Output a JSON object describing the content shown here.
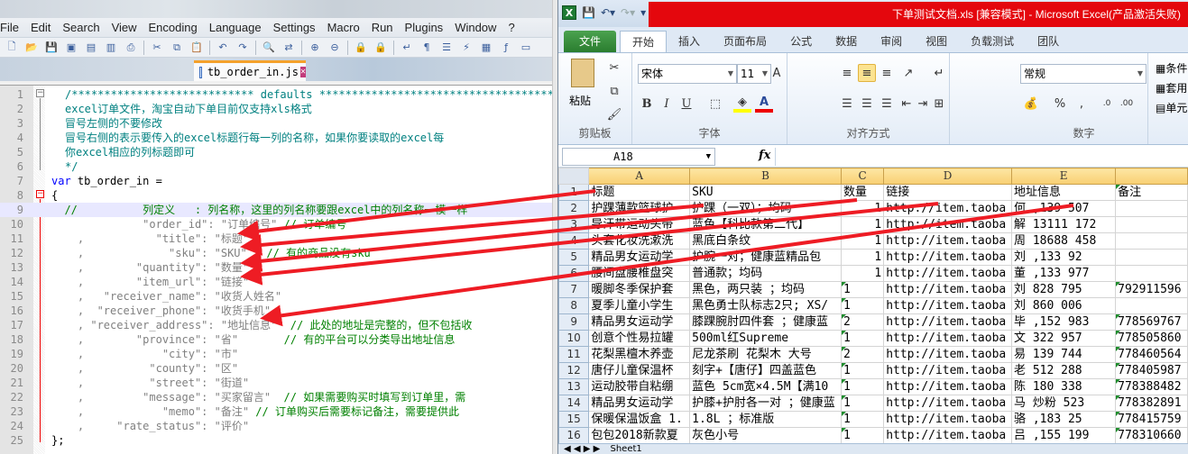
{
  "notepadpp": {
    "menu": [
      "File",
      "Edit",
      "Search",
      "View",
      "Encoding",
      "Language",
      "Settings",
      "Macro",
      "Run",
      "Plugins",
      "Window",
      "?"
    ],
    "tab_label": "tb_order_in.js",
    "lines": [
      {
        "n": "1",
        "parts": [
          {
            "t": "/**************************** defaults *****************************************",
            "c": "comment"
          }
        ]
      },
      {
        "n": "2",
        "parts": [
          {
            "t": "excel订单文件，淘宝自动下单目前仅支持xls格式",
            "c": "comment"
          }
        ]
      },
      {
        "n": "3",
        "parts": [
          {
            "t": "冒号左侧的不要修改",
            "c": "comment"
          }
        ]
      },
      {
        "n": "4",
        "parts": [
          {
            "t": "冒号右侧的表示要传入的excel标题行每一列的名称，如果你要读取的excel每",
            "c": "comment"
          }
        ]
      },
      {
        "n": "5",
        "parts": [
          {
            "t": "你excel相应的列标题即可",
            "c": "comment"
          }
        ]
      },
      {
        "n": "6",
        "parts": [
          {
            "t": "*/",
            "c": "comment"
          }
        ]
      },
      {
        "n": "7",
        "parts": [
          {
            "t": "var",
            "c": "kw"
          },
          {
            "t": " tb_order_in =",
            "c": "ident"
          }
        ]
      },
      {
        "n": "8",
        "parts": [
          {
            "t": "{",
            "c": "ident"
          }
        ]
      },
      {
        "n": "9",
        "parts": [
          {
            "t": "  //          列定义   : 列名称，这里的列名称要跟excel中的列名称一模一样",
            "c": "green"
          }
        ]
      },
      {
        "n": "10",
        "parts": [
          {
            "t": "              \"order_id\": \"订单编号\" ",
            "c": "str"
          },
          {
            "t": "// 订单编号",
            "c": "green"
          }
        ]
      },
      {
        "n": "11",
        "parts": [
          {
            "t": "    ,           \"title\": \"标题\"",
            "c": "str"
          }
        ]
      },
      {
        "n": "12",
        "parts": [
          {
            "t": "    ,             \"sku\": \"SKU\"   ",
            "c": "str"
          },
          {
            "t": "// 有的商品没有sku",
            "c": "green"
          }
        ]
      },
      {
        "n": "13",
        "parts": [
          {
            "t": "    ,        \"quantity\": \"数量\"",
            "c": "str"
          }
        ]
      },
      {
        "n": "14",
        "parts": [
          {
            "t": "    ,        \"item_url\": \"链接\"",
            "c": "str"
          }
        ]
      },
      {
        "n": "15",
        "parts": [
          {
            "t": "    ,   \"receiver_name\": \"收货人姓名\"",
            "c": "str"
          }
        ]
      },
      {
        "n": "16",
        "parts": [
          {
            "t": "    ,  \"receiver_phone\": \"收货手机\"",
            "c": "str"
          }
        ]
      },
      {
        "n": "17",
        "parts": [
          {
            "t": "    , \"receiver_address\": \"地址信息\"  ",
            "c": "str"
          },
          {
            "t": "// 此处的地址是完整的，但不包括收",
            "c": "green"
          }
        ]
      },
      {
        "n": "18",
        "parts": [
          {
            "t": "    ,        \"province\": \"省\"       ",
            "c": "str"
          },
          {
            "t": "// 有的平台可以分类导出地址信息",
            "c": "green"
          }
        ]
      },
      {
        "n": "19",
        "parts": [
          {
            "t": "    ,            \"city\": \"市\"",
            "c": "str"
          }
        ]
      },
      {
        "n": "20",
        "parts": [
          {
            "t": "    ,          \"county\": \"区\"",
            "c": "str"
          }
        ]
      },
      {
        "n": "21",
        "parts": [
          {
            "t": "    ,          \"street\": \"街道\"",
            "c": "str"
          }
        ]
      },
      {
        "n": "22",
        "parts": [
          {
            "t": "    ,         \"message\": \"买家留言\"  ",
            "c": "str"
          },
          {
            "t": "// 如果需要购买时填写到订单里，需",
            "c": "green"
          }
        ]
      },
      {
        "n": "23",
        "parts": [
          {
            "t": "    ,            \"memo\": \"备注\" ",
            "c": "str"
          },
          {
            "t": "// 订单购买后需要标记备注，需要提供此",
            "c": "green"
          }
        ]
      },
      {
        "n": "24",
        "parts": [
          {
            "t": "    ,     \"rate_status\": \"评价\"",
            "c": "str"
          }
        ]
      },
      {
        "n": "25",
        "parts": [
          {
            "t": "};",
            "c": "ident"
          }
        ]
      }
    ]
  },
  "excel": {
    "title": "下单测试文档.xls  [兼容模式]  -  Microsoft Excel(产品激活失败)",
    "logo": "X",
    "tabs": [
      "文件",
      "开始",
      "插入",
      "页面布局",
      "公式",
      "数据",
      "审阅",
      "视图",
      "负载测试",
      "团队"
    ],
    "ribbon": {
      "paste": "粘贴",
      "clipboard_group": "剪贴板",
      "font_name": "宋体",
      "font_size": "11",
      "font_group": "字体",
      "align_group": "对齐方式",
      "number_format": "常规",
      "number_group": "数字",
      "styles": [
        "条件",
        "套用",
        "单元"
      ],
      "bold": "B",
      "italic": "I",
      "underline": "U"
    },
    "name_box": "A18",
    "fx": "fx",
    "columns": [
      "A",
      "B",
      "C",
      "D",
      "E",
      ""
    ],
    "rows": [
      {
        "n": "1",
        "a": "标题",
        "b": "SKU",
        "c": "数量",
        "d": "链接",
        "e": "地址信息",
        "f": "备注"
      },
      {
        "n": "2",
        "a": "护踝薄款篮球护",
        "b": "护踝（一双）；均码",
        "c": "1",
        "d": "http://item.taoba",
        "e": "何 ,139  507",
        "f": ""
      },
      {
        "n": "3",
        "a": "导汗带运动头带",
        "b": "蓝色【科比款第二代】",
        "c": "1",
        "d": "http://item.taoba",
        "e": "解  13111 172",
        "f": ""
      },
      {
        "n": "4",
        "a": "头套化妆洗漱洗",
        "b": "黑底白条纹",
        "c": "1",
        "d": "http://item.taoba",
        "e": "周  18688 458",
        "f": ""
      },
      {
        "n": "5",
        "a": "精品男女运动学",
        "b": "护腕一对；健康蓝精品包",
        "c": "1",
        "d": "http://item.taoba",
        "e": "刘 ,133  92",
        "f": ""
      },
      {
        "n": "6",
        "a": "腰间盘腰椎盘突",
        "b": "普通款；均码",
        "c": "1",
        "d": "http://item.taoba",
        "e": "董 ,133  977",
        "f": ""
      },
      {
        "n": "7",
        "a": "暖脚冬季保护套",
        "b": "黑色，两只装 ；均码",
        "c": "1",
        "d": "http://item.taoba",
        "e": "刘 828  795",
        "f": "792911596"
      },
      {
        "n": "8",
        "a": "夏季儿童小学生",
        "b": "黑色勇士队标志2只; XS/",
        "c": "1",
        "d": "http://item.taoba",
        "e": "刘 860  006",
        "f": ""
      },
      {
        "n": "9",
        "a": "精品男女运动学",
        "b": "膝踝腕肘四件套 ；健康蓝",
        "c": "2",
        "d": "http://item.taoba",
        "e": "毕 ,152  983",
        "f": "778569767"
      },
      {
        "n": "10",
        "a": "创意个性易拉罐",
        "b": "500ml红Supreme",
        "c": "1",
        "d": "http://item.taoba",
        "e": "文 322  957",
        "f": "778505860"
      },
      {
        "n": "11",
        "a": "花梨黑檀木养壶",
        "b": "尼龙茶刷 花梨木 大号",
        "c": "2",
        "d": "http://item.taoba",
        "e": "易  139  744",
        "f": "778460564"
      },
      {
        "n": "12",
        "a": "唐仔儿童保温杯",
        "b": "刻字+【唐仔】四盖蓝色",
        "c": "1",
        "d": "http://item.taoba",
        "e": "老 512  288",
        "f": "778405987"
      },
      {
        "n": "13",
        "a": "运动胶带自粘绷",
        "b": "蓝色 5cm宽×4.5M【满10",
        "c": "1",
        "d": "http://item.taoba",
        "e": "陈  180  338",
        "f": "778388482"
      },
      {
        "n": "14",
        "a": "精品男女运动学",
        "b": "护膝+护肘各一对 ；健康蓝",
        "c": "1",
        "d": "http://item.taoba",
        "e": "马 炒粉  523",
        "f": "778382891"
      },
      {
        "n": "15",
        "a": "保暖保温饭盒 1.",
        "b": "1.8L ；标准版",
        "c": "1",
        "d": "http://item.taoba",
        "e": "骆 ,183  25",
        "f": "778415759"
      },
      {
        "n": "16",
        "a": "包包2018新款夏",
        "b": "灰色小号",
        "c": "1",
        "d": "http://item.taoba",
        "e": "吕 ,155  199",
        "f": "778310660"
      }
    ],
    "sheet_tab": "Sheet1"
  }
}
